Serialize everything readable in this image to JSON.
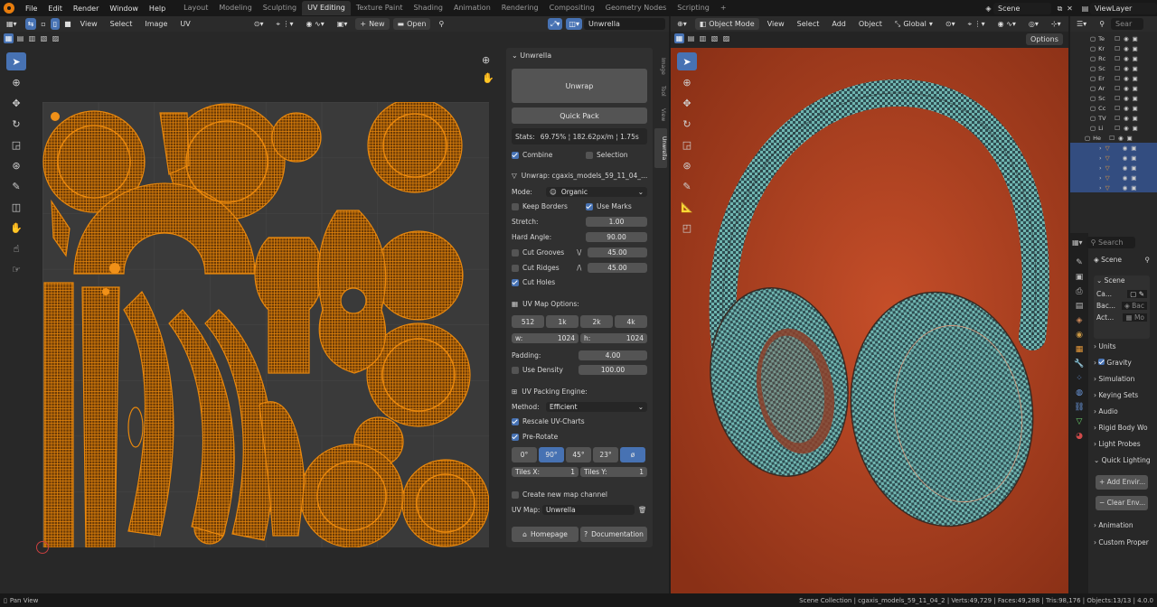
{
  "topbar": {
    "menus": [
      "File",
      "Edit",
      "Render",
      "Window",
      "Help"
    ],
    "workspaces": [
      "Layout",
      "Modeling",
      "Sculpting",
      "UV Editing",
      "Texture Paint",
      "Shading",
      "Animation",
      "Rendering",
      "Compositing",
      "Geometry Nodes",
      "Scripting"
    ],
    "active_workspace": "UV Editing",
    "add_tab": "+",
    "scene": "Scene",
    "view_layer": "ViewLayer"
  },
  "uv_header": {
    "menus": [
      "View",
      "Select",
      "Image",
      "UV"
    ],
    "new_label": "New",
    "open_label": "Open",
    "uv_map_name": "Unwrella"
  },
  "viewport_header": {
    "mode": "Object Mode",
    "menus": [
      "View",
      "Select",
      "Add",
      "Object"
    ],
    "orientation": "Global",
    "options_label": "Options"
  },
  "side_tabs": [
    "Image",
    "Tool",
    "View",
    "Unwrella"
  ],
  "npanel": {
    "title": "Unwrella",
    "unwrap_button": "Unwrap",
    "quick_pack_button": "Quick Pack",
    "stats_label": "Stats:",
    "stats_value": "69.75% ¦ 182.62px/m ¦ 1.75s",
    "combine_label": "Combine",
    "combine_checked": true,
    "selection_label": "Selection",
    "selection_checked": false,
    "unwrap_section": "Unwrap: cgaxis_models_59_11_04_...",
    "mode_label": "Mode:",
    "mode_value": "Organic",
    "keep_borders_label": "Keep Borders",
    "use_marks_label": "Use Marks",
    "stretch_label": "Stretch:",
    "stretch_value": "1.00",
    "hard_angle_label": "Hard Angle:",
    "hard_angle_value": "90.00",
    "cut_grooves_label": "Cut Grooves",
    "cut_grooves_value": "45.00",
    "cut_ridges_label": "Cut Ridges",
    "cut_ridges_value": "45.00",
    "cut_holes_label": "Cut Holes",
    "uv_map_options_label": "UV Map Options:",
    "res_buttons": [
      "512",
      "1k",
      "2k",
      "4k"
    ],
    "w_label": "w:",
    "w_value": "1024",
    "h_label": "h:",
    "h_value": "1024",
    "padding_label": "Padding:",
    "padding_value": "4.00",
    "use_density_label": "Use Density",
    "use_density_value": "100.00",
    "packing_engine_label": "UV Packing Engine:",
    "method_label": "Method:",
    "method_value": "Efficient",
    "rescale_label": "Rescale UV-Charts",
    "prerotate_label": "Pre-Rotate",
    "rot_buttons": [
      "0°",
      "90°",
      "45°",
      "23°",
      "ø"
    ],
    "tiles_x_label": "Tiles X:",
    "tiles_x_value": "1",
    "tiles_y_label": "Tiles Y:",
    "tiles_y_value": "1",
    "create_channel_label": "Create new map channel",
    "uv_map_label": "UV Map:",
    "uv_map_value": "Unwrella",
    "homepage_label": "Homepage",
    "documentation_label": "Documentation"
  },
  "outliner": {
    "items": [
      "Te",
      "Kr",
      "Rc",
      "Sc",
      "Er",
      "Ar",
      "Sc",
      "Cc",
      "TV",
      "Li",
      "He"
    ]
  },
  "properties": {
    "search_placeholder": "Search",
    "scene_header": "Scene",
    "scene_section": "Scene",
    "rows": [
      "Ca...",
      "Bac...",
      "Act..."
    ],
    "row_values": [
      "",
      "Bac",
      "Mo"
    ],
    "sections": [
      "Units",
      "Gravity",
      "Simulation",
      "Keying Sets",
      "Audio",
      "Rigid Body Wo",
      "Light Probes",
      "Quick Lighting"
    ],
    "add_env": "Add Envir...",
    "clear_env": "Clear Env...",
    "tail_sections": [
      "Animation",
      "Custom Proper"
    ]
  },
  "status": {
    "left": "Pan View",
    "right": "Scene Collection | cgaxis_models_59_11_04_2 | Verts:49,729 | Faces:49,288 | Tris:98,176 | Objects:13/13 | 4.0.0"
  },
  "colors": {
    "accent": "#4772b3",
    "uv_orange": "#e8870c",
    "viewport_bg": "#a83f1e",
    "checker_teal": "#5fa8a6"
  }
}
